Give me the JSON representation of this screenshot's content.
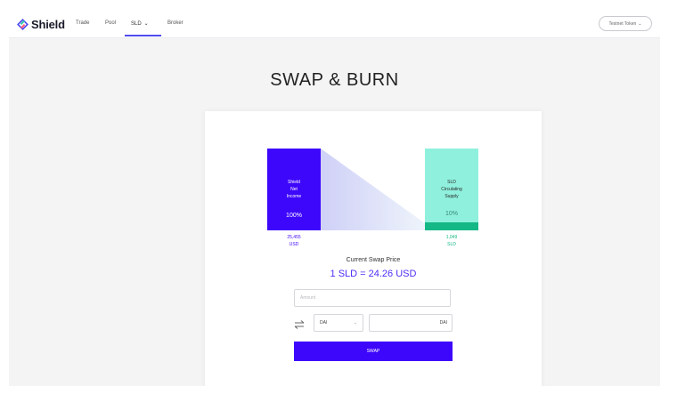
{
  "navbar": {
    "brand": "Shield",
    "items": [
      {
        "label": "Trade"
      },
      {
        "label": "Pool"
      },
      {
        "label": "SLD"
      },
      {
        "label": "Broker"
      }
    ],
    "token_button": "Testnet Token"
  },
  "page": {
    "title": "SWAP & BURN"
  },
  "chart": {
    "left": {
      "line1": "Shield",
      "line2": "Net",
      "line3": "Income",
      "percent": "100%",
      "value_amount": "25,455",
      "value_unit": "USD"
    },
    "right": {
      "line1": "SLD",
      "line2": "Circulating",
      "line3": "Supply",
      "percent": "10%",
      "fill_fraction": 0.1,
      "value_amount": "1,049",
      "value_unit": "SLD"
    }
  },
  "price": {
    "label": "Current Swap Price",
    "value": "1 SLD = 24.26 USD"
  },
  "form": {
    "amount_placeholder": "Amount",
    "token_selected": "DAI",
    "output_unit": "DAI",
    "swap_label": "SWAP"
  },
  "colors": {
    "accent": "#3d07fb",
    "supply": "#8ff1dd",
    "supply_fill": "#14b885"
  }
}
